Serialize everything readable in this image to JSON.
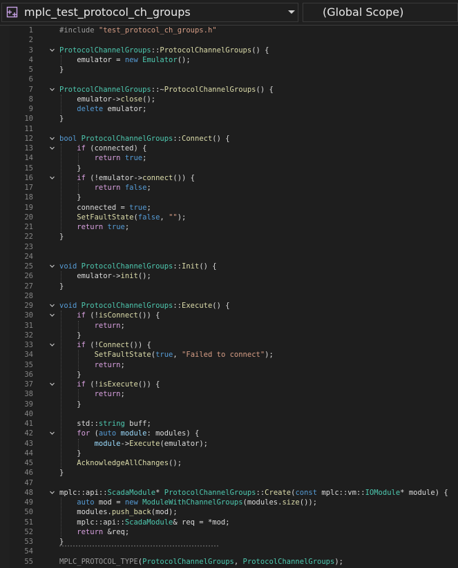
{
  "toolbar": {
    "file_scope": "mplc_test_protocol_ch_groups",
    "member_scope": "(Global Scope)"
  },
  "colors": {
    "keyword": "#569cd6",
    "control": "#d8a0df",
    "type": "#4ec9b0",
    "function": "#dcdcaa",
    "string": "#d69d85",
    "macro": "#9b9b9b",
    "line_number": "#858585",
    "background": "#1e1e1e"
  },
  "editor": {
    "lines": [
      {
        "n": "1",
        "tokens": [
          [
            "m",
            "#include "
          ],
          [
            "s",
            "\"test_protocol_ch_groups.h\""
          ]
        ]
      },
      {
        "n": "2",
        "tokens": []
      },
      {
        "n": "3",
        "fold": true,
        "tokens": [
          [
            "t",
            "ProtocolChannelGroups"
          ],
          [
            "p",
            "::"
          ],
          [
            "f",
            "ProtocolChannelGroups"
          ],
          [
            "p",
            "() {"
          ]
        ]
      },
      {
        "n": "4",
        "tokens": [
          [
            "p",
            "    emulator = "
          ],
          [
            "k",
            "new "
          ],
          [
            "t",
            "Emulator"
          ],
          [
            "p",
            "();"
          ]
        ]
      },
      {
        "n": "5",
        "tokens": [
          [
            "p",
            "}"
          ]
        ]
      },
      {
        "n": "6",
        "tokens": []
      },
      {
        "n": "7",
        "fold": true,
        "tokens": [
          [
            "t",
            "ProtocolChannelGroups"
          ],
          [
            "p",
            "::~"
          ],
          [
            "f",
            "ProtocolChannelGroups"
          ],
          [
            "p",
            "() {"
          ]
        ]
      },
      {
        "n": "8",
        "tokens": [
          [
            "p",
            "    emulator->"
          ],
          [
            "f",
            "close"
          ],
          [
            "p",
            "();"
          ]
        ]
      },
      {
        "n": "9",
        "tokens": [
          [
            "k",
            "    delete "
          ],
          [
            "p",
            "emulator;"
          ]
        ]
      },
      {
        "n": "10",
        "tokens": [
          [
            "p",
            "}"
          ]
        ]
      },
      {
        "n": "11",
        "tokens": []
      },
      {
        "n": "12",
        "fold": true,
        "tokens": [
          [
            "k",
            "bool "
          ],
          [
            "t",
            "ProtocolChannelGroups"
          ],
          [
            "p",
            "::"
          ],
          [
            "f",
            "Connect"
          ],
          [
            "p",
            "() {"
          ]
        ]
      },
      {
        "n": "13",
        "fold": true,
        "tokens": [
          [
            "ctl",
            "    if "
          ],
          [
            "p",
            "(connected) {"
          ]
        ]
      },
      {
        "n": "14",
        "tokens": [
          [
            "ctl",
            "        return "
          ],
          [
            "k",
            "true"
          ],
          [
            "p",
            ";"
          ]
        ]
      },
      {
        "n": "15",
        "tokens": [
          [
            "p",
            "    }"
          ]
        ]
      },
      {
        "n": "16",
        "fold": true,
        "tokens": [
          [
            "ctl",
            "    if "
          ],
          [
            "p",
            "(!emulator->"
          ],
          [
            "f",
            "connect"
          ],
          [
            "p",
            "()) {"
          ]
        ]
      },
      {
        "n": "17",
        "tokens": [
          [
            "ctl",
            "        return "
          ],
          [
            "k",
            "false"
          ],
          [
            "p",
            ";"
          ]
        ]
      },
      {
        "n": "18",
        "tokens": [
          [
            "p",
            "    }"
          ]
        ]
      },
      {
        "n": "19",
        "tokens": [
          [
            "p",
            "    connected = "
          ],
          [
            "k",
            "true"
          ],
          [
            "p",
            ";"
          ]
        ]
      },
      {
        "n": "20",
        "tokens": [
          [
            "f",
            "    SetFaultState"
          ],
          [
            "p",
            "("
          ],
          [
            "k",
            "false"
          ],
          [
            "p",
            ", "
          ],
          [
            "s",
            "\"\""
          ],
          [
            "p",
            ");"
          ]
        ]
      },
      {
        "n": "21",
        "tokens": [
          [
            "ctl",
            "    return "
          ],
          [
            "k",
            "true"
          ],
          [
            "p",
            ";"
          ]
        ]
      },
      {
        "n": "22",
        "tokens": [
          [
            "p",
            "}"
          ]
        ]
      },
      {
        "n": "23",
        "tokens": []
      },
      {
        "n": "24",
        "tokens": []
      },
      {
        "n": "25",
        "fold": true,
        "tokens": [
          [
            "k",
            "void "
          ],
          [
            "t",
            "ProtocolChannelGroups"
          ],
          [
            "p",
            "::"
          ],
          [
            "f",
            "Init"
          ],
          [
            "p",
            "() {"
          ]
        ]
      },
      {
        "n": "26",
        "tokens": [
          [
            "p",
            "    emulator->"
          ],
          [
            "f",
            "init"
          ],
          [
            "p",
            "();"
          ]
        ]
      },
      {
        "n": "27",
        "tokens": [
          [
            "p",
            "}"
          ]
        ]
      },
      {
        "n": "28",
        "tokens": []
      },
      {
        "n": "29",
        "fold": true,
        "tokens": [
          [
            "k",
            "void "
          ],
          [
            "t",
            "ProtocolChannelGroups"
          ],
          [
            "p",
            "::"
          ],
          [
            "f",
            "Execute"
          ],
          [
            "p",
            "() {"
          ]
        ]
      },
      {
        "n": "30",
        "fold": true,
        "tokens": [
          [
            "ctl",
            "    if "
          ],
          [
            "p",
            "(!"
          ],
          [
            "f",
            "isConnect"
          ],
          [
            "p",
            "()) {"
          ]
        ]
      },
      {
        "n": "31",
        "tokens": [
          [
            "ctl",
            "        return"
          ],
          [
            "p",
            ";"
          ]
        ]
      },
      {
        "n": "32",
        "tokens": [
          [
            "p",
            "    }"
          ]
        ]
      },
      {
        "n": "33",
        "fold": true,
        "tokens": [
          [
            "ctl",
            "    if "
          ],
          [
            "p",
            "(!"
          ],
          [
            "f",
            "Connect"
          ],
          [
            "p",
            "()) {"
          ]
        ]
      },
      {
        "n": "34",
        "tokens": [
          [
            "f",
            "        SetFaultState"
          ],
          [
            "p",
            "("
          ],
          [
            "k",
            "true"
          ],
          [
            "p",
            ", "
          ],
          [
            "s",
            "\"Failed to connect\""
          ],
          [
            "p",
            ");"
          ]
        ]
      },
      {
        "n": "35",
        "tokens": [
          [
            "ctl",
            "        return"
          ],
          [
            "p",
            ";"
          ]
        ]
      },
      {
        "n": "36",
        "tokens": [
          [
            "p",
            "    }"
          ]
        ]
      },
      {
        "n": "37",
        "fold": true,
        "tokens": [
          [
            "ctl",
            "    if "
          ],
          [
            "p",
            "(!"
          ],
          [
            "f",
            "isExecute"
          ],
          [
            "p",
            "()) {"
          ]
        ]
      },
      {
        "n": "38",
        "tokens": [
          [
            "ctl",
            "        return"
          ],
          [
            "p",
            ";"
          ]
        ]
      },
      {
        "n": "39",
        "tokens": [
          [
            "p",
            "    }"
          ]
        ]
      },
      {
        "n": "40",
        "tokens": []
      },
      {
        "n": "41",
        "tokens": [
          [
            "p",
            "    std::"
          ],
          [
            "t",
            "string "
          ],
          [
            "p",
            "buff;"
          ]
        ]
      },
      {
        "n": "42",
        "fold": true,
        "tokens": [
          [
            "ctl",
            "    for "
          ],
          [
            "p",
            "("
          ],
          [
            "k",
            "auto "
          ],
          [
            "v",
            "module"
          ],
          [
            "p",
            ": modules) {"
          ]
        ]
      },
      {
        "n": "43",
        "tokens": [
          [
            "v",
            "        module"
          ],
          [
            "p",
            "->"
          ],
          [
            "f",
            "Execute"
          ],
          [
            "p",
            "(emulator);"
          ]
        ]
      },
      {
        "n": "44",
        "tokens": [
          [
            "p",
            "    }"
          ]
        ]
      },
      {
        "n": "45",
        "tokens": [
          [
            "f",
            "    AcknowledgeAllChanges"
          ],
          [
            "p",
            "();"
          ]
        ]
      },
      {
        "n": "46",
        "tokens": [
          [
            "p",
            "}"
          ]
        ]
      },
      {
        "n": "47",
        "tokens": []
      },
      {
        "n": "48",
        "fold": true,
        "tokens": [
          [
            "p",
            "mplc::api::"
          ],
          [
            "t",
            "ScadaModule"
          ],
          [
            "p",
            "* "
          ],
          [
            "t",
            "ProtocolChannelGroups"
          ],
          [
            "p",
            "::"
          ],
          [
            "f",
            "Create"
          ],
          [
            "p",
            "("
          ],
          [
            "k",
            "const "
          ],
          [
            "p",
            "mplc::vm::"
          ],
          [
            "t",
            "IOModule"
          ],
          [
            "p",
            "* module) {"
          ]
        ]
      },
      {
        "n": "49",
        "tokens": [
          [
            "k",
            "    auto "
          ],
          [
            "p",
            "mod = "
          ],
          [
            "k",
            "new "
          ],
          [
            "t",
            "ModuleWithChannelGroups"
          ],
          [
            "p",
            "(modules."
          ],
          [
            "f",
            "size"
          ],
          [
            "p",
            "());"
          ]
        ]
      },
      {
        "n": "50",
        "tokens": [
          [
            "p",
            "    modules."
          ],
          [
            "f",
            "push_back"
          ],
          [
            "p",
            "(mod);"
          ]
        ]
      },
      {
        "n": "51",
        "tokens": [
          [
            "p",
            "    mplc::api::"
          ],
          [
            "t",
            "ScadaModule"
          ],
          [
            "p",
            "& req = *mod;"
          ]
        ]
      },
      {
        "n": "52",
        "tokens": [
          [
            "ctl",
            "    return "
          ],
          [
            "p",
            "&req;"
          ]
        ]
      },
      {
        "n": "53",
        "tokens": [
          [
            "p",
            "}"
          ]
        ]
      },
      {
        "n": "54",
        "tokens": []
      },
      {
        "n": "55",
        "tokens": [
          [
            "m",
            "MPLC_PROTOCOL_TYPE"
          ],
          [
            "p",
            "("
          ],
          [
            "t",
            "ProtocolChannelGroups"
          ],
          [
            "p",
            ", "
          ],
          [
            "t",
            "ProtocolChannelGroups"
          ],
          [
            "p",
            ");"
          ]
        ]
      }
    ]
  }
}
